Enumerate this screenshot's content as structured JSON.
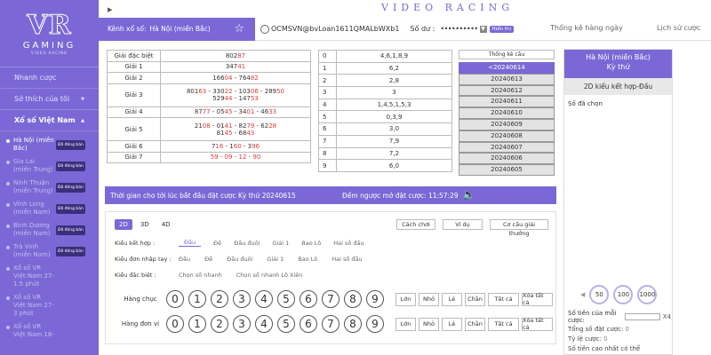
{
  "brand": {
    "logo": "VR",
    "gaming": "GAMING",
    "sub": "VIDEO RACING",
    "title": "VIDEO RACING"
  },
  "sidebar": {
    "items": [
      {
        "label": "Nhanh cược"
      },
      {
        "label": "Sở thích của tôi",
        "arrow": "▼"
      },
      {
        "label": "Xổ số Việt Nam",
        "arrow": "▲"
      }
    ],
    "lotteries": [
      {
        "name": "Hà Nội (miền Bắc)",
        "badge": "Đã đóng bán",
        "active": true
      },
      {
        "name": "Gia Lai (miền Trung)",
        "badge": "Đã đóng bán"
      },
      {
        "name": "Ninh Thuận (miền Trung)",
        "badge": "Đã đóng bán"
      },
      {
        "name": "Vĩnh Long (miền Nam)",
        "badge": "Đã đóng bán"
      },
      {
        "name": "Bình Dương (miền Nam)",
        "badge": "Đã đóng bán"
      },
      {
        "name": "Trà Vinh (miền Nam)",
        "badge": "Đã đóng bán"
      },
      {
        "name": "Xổ số VR Việt Nam 27-1.5 phút",
        "badge": ""
      },
      {
        "name": "Xổ số VR Việt Nam 27-3 phút",
        "badge": ""
      },
      {
        "name": "Xổ số VR Việt Nam 18-",
        "badge": ""
      }
    ]
  },
  "header": {
    "channel_label": "Kênh xổ số:",
    "channel_value": "Hà Nội (miền Bắc)",
    "username": "OCMSVN@bvLoan1611QMALbWXb1",
    "balance_label": "Số dư :",
    "balance_value": "••••••••••",
    "show_balance": "Hiển thị",
    "stats_link": "Thống kê hàng ngày",
    "history_link": "Lịch sử cược"
  },
  "results": [
    {
      "label": "Giải đặc biệt",
      "lines": [
        [
          [
            "802",
            ""
          ],
          [
            "87",
            "red"
          ]
        ]
      ]
    },
    {
      "label": "Giải 1",
      "lines": [
        [
          [
            "347",
            ""
          ],
          [
            "41",
            "red"
          ]
        ]
      ]
    },
    {
      "label": "Giải 2",
      "lines": [
        [
          [
            "166",
            ""
          ],
          [
            "04",
            "red"
          ],
          [
            " - 764",
            ""
          ],
          [
            "82",
            "red"
          ]
        ]
      ]
    },
    {
      "label": "Giải 3",
      "lines": [
        [
          [
            "801",
            ""
          ],
          [
            "63",
            "red"
          ],
          [
            " - 330",
            ""
          ],
          [
            "22",
            "red"
          ],
          [
            " - 103",
            ""
          ],
          [
            "06",
            "red"
          ],
          [
            " - 289",
            ""
          ],
          [
            "50",
            "red"
          ]
        ],
        [
          [
            "529",
            ""
          ],
          [
            "44",
            "red"
          ],
          [
            " - 147",
            ""
          ],
          [
            "53",
            "red"
          ]
        ]
      ]
    },
    {
      "label": "Giải 4",
      "lines": [
        [
          [
            "87",
            ""
          ],
          [
            "77",
            "red"
          ],
          [
            " - 05",
            ""
          ],
          [
            "45",
            "red"
          ],
          [
            " - 34",
            ""
          ],
          [
            "01",
            "red"
          ],
          [
            " - 46",
            ""
          ],
          [
            "33",
            "red"
          ]
        ]
      ]
    },
    {
      "label": "Giải 5",
      "lines": [
        [
          [
            "21",
            ""
          ],
          [
            "08",
            "red"
          ],
          [
            " - 01",
            ""
          ],
          [
            "41",
            "red"
          ],
          [
            " - 82",
            ""
          ],
          [
            "79",
            "red"
          ],
          [
            " - 62",
            ""
          ],
          [
            "28",
            "red"
          ]
        ],
        [
          [
            "81",
            ""
          ],
          [
            "45",
            "red"
          ],
          [
            " - 68",
            ""
          ],
          [
            "43",
            "red"
          ]
        ]
      ]
    },
    {
      "label": "Giải 6",
      "lines": [
        [
          [
            "7",
            ""
          ],
          [
            "16",
            "red"
          ],
          [
            " - 1",
            ""
          ],
          [
            "60",
            "red"
          ],
          [
            " - 3",
            ""
          ],
          [
            "96",
            "red"
          ]
        ]
      ]
    },
    {
      "label": "Giải 7",
      "lines": [
        [
          [
            "59 - 09 - 12 - 90",
            "red"
          ]
        ]
      ]
    }
  ],
  "digits": [
    {
      "d": "0",
      "v": "4,6,1,8,9"
    },
    {
      "d": "1",
      "v": "6,2"
    },
    {
      "d": "2",
      "v": "2,8"
    },
    {
      "d": "3",
      "v": "3"
    },
    {
      "d": "4",
      "v": "1,4,5,1,5,3"
    },
    {
      "d": "5",
      "v": "0,3,9"
    },
    {
      "d": "6",
      "v": "3,0"
    },
    {
      "d": "7",
      "v": "7,9"
    },
    {
      "d": "8",
      "v": "7,2"
    },
    {
      "d": "9",
      "v": "6,0"
    }
  ],
  "stats": {
    "title": "Thống kê cầu",
    "dates": [
      "<20240614",
      "20240613",
      "20240612",
      "20240611",
      "20240610",
      "20240609",
      "20240608",
      "20240607",
      "20240606",
      "20240605"
    ]
  },
  "timebar": {
    "time_text": "Thời gian cho tới lúc bắt đầu đặt cược Kỳ thứ 20240615",
    "countdown": "Đếm ngược mở đặt cược: 11:57:29"
  },
  "bet": {
    "tabs": [
      "2D",
      "3D",
      "4D"
    ],
    "actions": [
      "Cách chơi",
      "Ví dụ",
      "Cơ cấu giải thưởng"
    ],
    "row1": {
      "label": "Kiểu kết hợp :",
      "opts": [
        "Đầu",
        "Đề",
        "Đầu đuôi",
        "Giải 1",
        "Bao Lô",
        "Hai số đầu"
      ]
    },
    "row2": {
      "label": "Kiểu đơn nhập tay :",
      "opts": [
        "Đầu",
        "Đề",
        "Đầu đuôi",
        "Giải 1",
        "Bao Lô",
        "Hai số đầu"
      ]
    },
    "row3": {
      "label": "Kiểu đặc biệt :",
      "opts": [
        "Chọn số nhanh",
        "Chọn số nhanh Lô Xiên"
      ]
    },
    "row_labels": [
      "Hàng chục",
      "Hàng đơn vị"
    ],
    "balls": [
      "0",
      "1",
      "2",
      "3",
      "4",
      "5",
      "6",
      "7",
      "8",
      "9"
    ],
    "quick": [
      "Lớn",
      "Nhỏ",
      "Lẻ",
      "Chẵn",
      "Tất cả",
      "Xóa tất cả"
    ]
  },
  "panel": {
    "region": "Hà Nội (miền Bắc)",
    "period": "Kỳ thứ",
    "type": "2D kiểu kết hợp-Đầu",
    "chosen": "Số đã chọn",
    "chips": [
      "50",
      "100",
      "1000"
    ],
    "money_label": "Số tiền của mỗi cược:",
    "multiplier": "X4",
    "total_label": "Tổng số đặt cược:",
    "total_value": "0",
    "ratio_label": "Tỷ lệ cược:",
    "ratio_value": "0",
    "max_label": "Số tiền cao nhất có thể"
  },
  "colors": {
    "accent": "#7b68d6",
    "red": "#e03a3a"
  }
}
